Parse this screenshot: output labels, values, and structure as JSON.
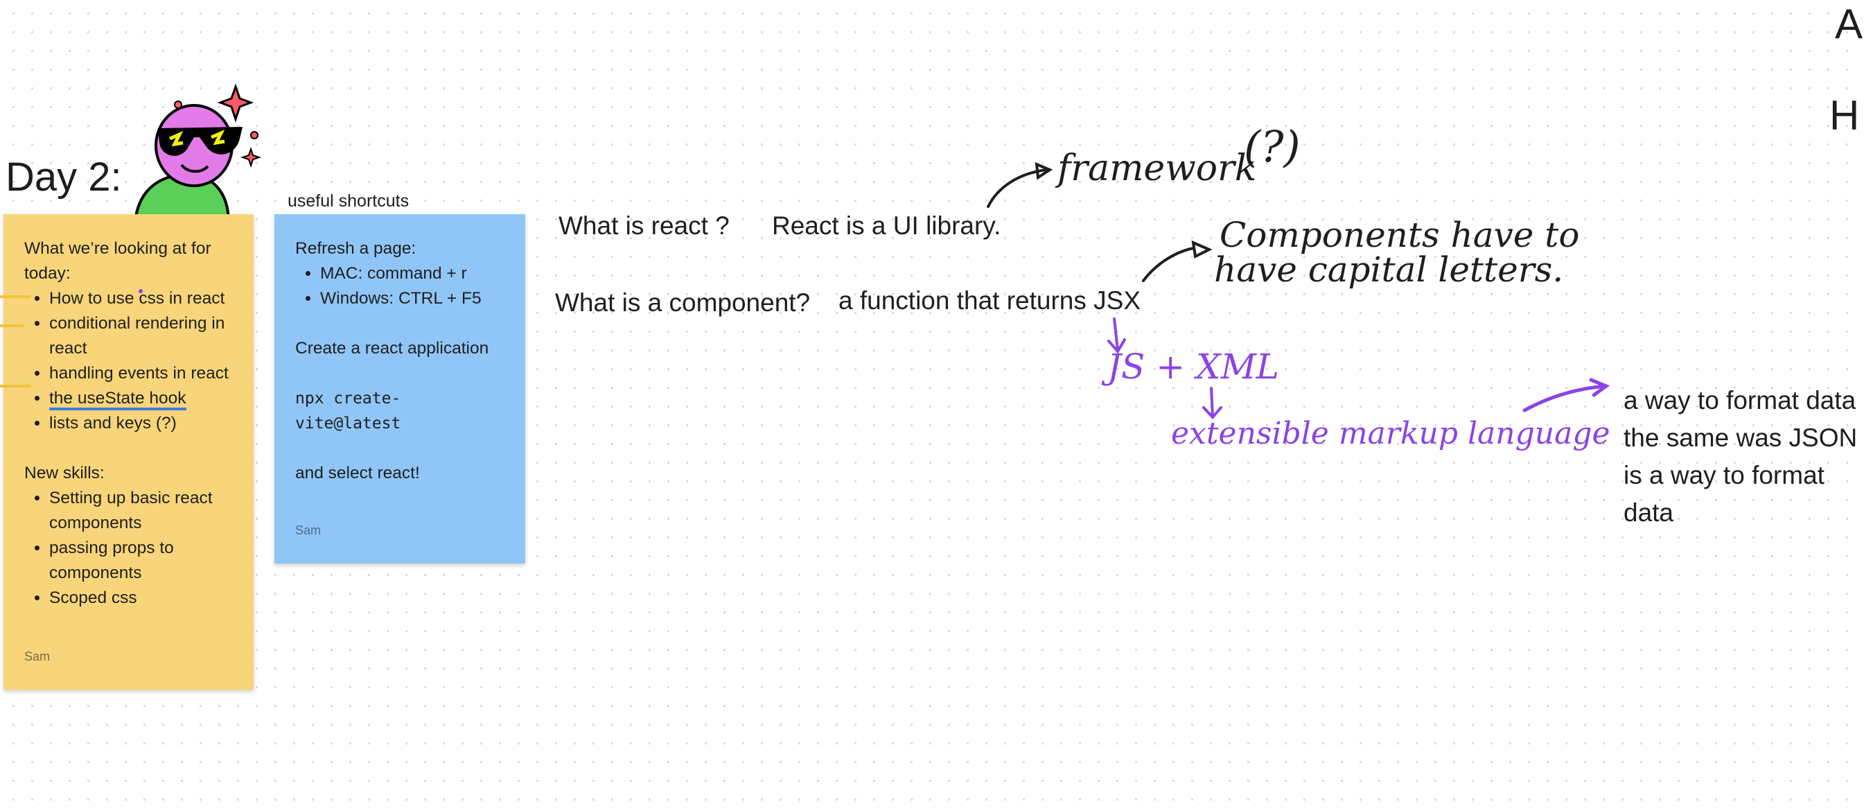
{
  "heading": "Day 2:",
  "shortcuts_title": "useful shortcuts",
  "yellow_note": {
    "intro": "What we’re looking at for today:",
    "topics": [
      "How to use css in react",
      "conditional rendering in react",
      "handling events in react",
      "the useState hook",
      "lists and keys (?)"
    ],
    "skills_title": "New skills:",
    "skills": [
      "Setting up basic react components",
      "passing props to components",
      "Scoped css"
    ],
    "author": "Sam",
    "color": "#f8d57a"
  },
  "blue_note": {
    "refresh_title": "Refresh a page:",
    "refresh_items": [
      "MAC: command + r",
      "Windows: CTRL + F5"
    ],
    "create_title": "Create a react application",
    "command": "npx create-vite@latest",
    "select": "and select react!",
    "author": "Sam",
    "color": "#90c6f7"
  },
  "canvas": {
    "q1": "What is react ?",
    "a1": "React is a UI library.",
    "hand_framework": "framework",
    "hand_question": "(?)",
    "q2": "What is a component?",
    "a2": "a function that returns JSX",
    "hand_components_line1": "Components have to",
    "hand_components_line2": "have capital letters.",
    "hand_jsx": "JS + XML",
    "hand_extensible": "extensible markup language",
    "json_note": "a way to format data the same was JSON is a way to format data",
    "edge_letter_1": "A",
    "edge_letter_2": "H"
  },
  "colors": {
    "ink": "#1e1e1e",
    "purple_ink": "#8a43e6",
    "sticker_pink": "#e27be8",
    "sticker_green": "#5ccf5a",
    "sticker_yellow": "#f2f20a"
  }
}
